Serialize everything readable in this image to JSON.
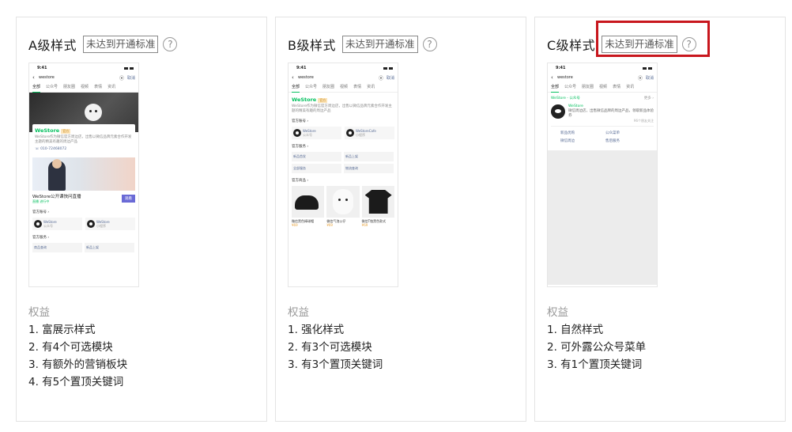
{
  "colors": {
    "accent_green": "#07c160",
    "highlight_red": "#c8161d",
    "link_blue": "#576b95"
  },
  "help_glyph": "?",
  "cards": [
    {
      "title": "A级样式",
      "status": "未达到开通标准",
      "rights_title": "权益",
      "rights": [
        "1. 富展示样式",
        "2. 有4个可选模块",
        "3. 有额外的营销板块",
        "4. 有5个置顶关键词"
      ]
    },
    {
      "title": "B级样式",
      "status": "未达到开通标准",
      "rights_title": "权益",
      "rights": [
        "1. 强化样式",
        "2. 有3个可选模块",
        "3. 有3个置顶关键词"
      ]
    },
    {
      "title": "C级样式",
      "status": "未达到开通标准",
      "rights_title": "权益",
      "rights": [
        "1. 自然样式",
        "2. 可外露公众号菜单",
        "3. 有1个置顶关键词"
      ]
    }
  ],
  "phone": {
    "time": "9:41",
    "query": "westore",
    "cancel": "取消",
    "tabs": [
      "全部",
      "公众号",
      "朋友圈",
      "视频",
      "表情",
      "资讯"
    ]
  },
  "preview_a": {
    "store_name": "WeStore",
    "store_tag": "官方",
    "store_desc": "WeStore作为微信官方周边店，出售以微信品牌元素合作开发主题的精美有趣的周边产品",
    "phone": "010-72468072",
    "live_title": "WeStore公开课快问直播",
    "live_sub": "直播  进行中",
    "live_btn": "观看",
    "accounts_title": "官方账号",
    "accounts": [
      {
        "name": "WeStore",
        "sub": "公众号"
      },
      {
        "name": "WeStore",
        "sub": "小程序"
      }
    ],
    "services_title": "官方服务",
    "services": [
      "商品查询",
      "新品上架"
    ]
  },
  "preview_b": {
    "store_name": "WeStore",
    "store_tag": "官方",
    "store_desc": "WeStore作为微信官方周边店，出售以微信品牌元素合作开发主题的精美有趣的周边产品",
    "accounts_title": "官方账号",
    "accounts": [
      {
        "name": "WeStore",
        "sub": "公众号"
      },
      {
        "name": "WeStoreCafe",
        "sub": "小程序"
      }
    ],
    "services_title": "官方服务",
    "services": [
      "新品首发",
      "新品上架",
      "全部服务",
      "物流查询"
    ],
    "goods_title": "官方商品",
    "goods": [
      {
        "name": "微信黑色棒球帽",
        "price": "¥69"
      },
      {
        "name": "微信气泡公仔",
        "price": "¥69"
      },
      {
        "name": "微信T恤黑色款式",
        "price": "¥69"
      }
    ]
  },
  "preview_c": {
    "head": "WeStore - 公众号",
    "more": "更多",
    "name": "WeStore",
    "desc": "微信周边店，出售微信品牌的周边产品，领取新品体验券",
    "note": "96个朋友关注",
    "menu": [
      "新品优购",
      "公众菜单",
      "微信周边",
      "售后服务"
    ]
  }
}
